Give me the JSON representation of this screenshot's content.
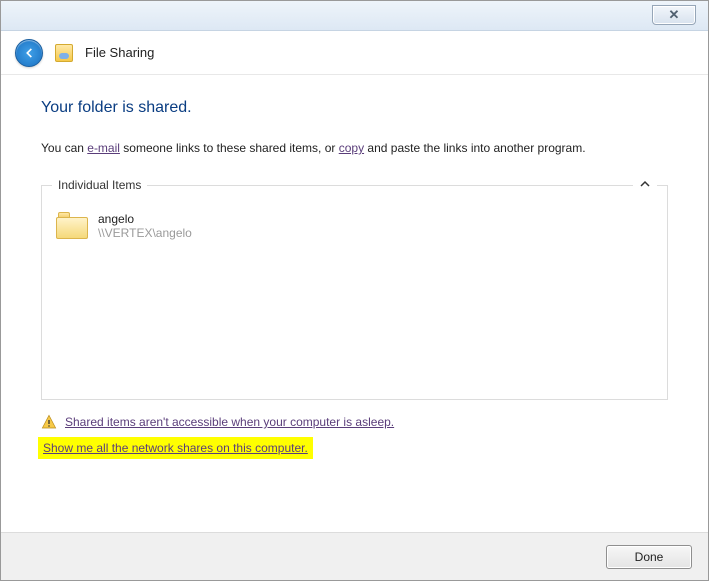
{
  "window": {
    "close_label": "✕"
  },
  "header": {
    "title": "File Sharing"
  },
  "main": {
    "heading": "Your folder is shared.",
    "desc_part1": "You can ",
    "email_link": "e-mail",
    "desc_part2": " someone links to these shared items, or ",
    "copy_link": "copy",
    "desc_part3": " and paste the links into another program."
  },
  "group": {
    "legend": "Individual Items",
    "items": [
      {
        "name": "angelo",
        "path": "\\\\VERTEX\\angelo"
      }
    ]
  },
  "warning": {
    "text": "Shared items aren't accessible when your computer is asleep."
  },
  "highlight": {
    "text": "Show me all the network shares on this computer."
  },
  "footer": {
    "done_label": "Done"
  }
}
